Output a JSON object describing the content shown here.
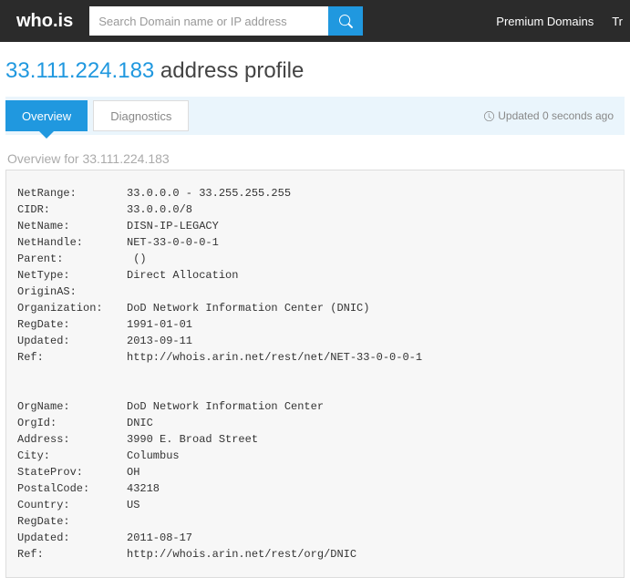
{
  "header": {
    "logo_text": "who.is",
    "search_placeholder": "Search Domain name or IP address",
    "nav": {
      "premium": "Premium Domains",
      "trunc": "Tr"
    }
  },
  "page": {
    "ip": "33.111.224.183",
    "title_suffix": " address profile"
  },
  "tabs": {
    "overview": "Overview",
    "diagnostics": "Diagnostics",
    "updated": "Updated 0 seconds ago"
  },
  "section": {
    "overview_prefix": "Overview for ",
    "overview_ip": "33.111.224.183"
  },
  "whois": {
    "block1": [
      {
        "k": "NetRange:",
        "v": "33.0.0.0 - 33.255.255.255"
      },
      {
        "k": "CIDR:",
        "v": "33.0.0.0/8"
      },
      {
        "k": "NetName:",
        "v": "DISN-IP-LEGACY"
      },
      {
        "k": "NetHandle:",
        "v": "NET-33-0-0-0-1"
      },
      {
        "k": "Parent:",
        "v": " ()"
      },
      {
        "k": "NetType:",
        "v": "Direct Allocation"
      },
      {
        "k": "OriginAS:",
        "v": ""
      },
      {
        "k": "Organization:",
        "v": "DoD Network Information Center (DNIC)"
      },
      {
        "k": "RegDate:",
        "v": "1991-01-01"
      },
      {
        "k": "Updated:",
        "v": "2013-09-11"
      },
      {
        "k": "Ref:",
        "v": "http://whois.arin.net/rest/net/NET-33-0-0-0-1"
      }
    ],
    "block2": [
      {
        "k": "OrgName:",
        "v": "DoD Network Information Center"
      },
      {
        "k": "OrgId:",
        "v": "DNIC"
      },
      {
        "k": "Address:",
        "v": "3990 E. Broad Street"
      },
      {
        "k": "City:",
        "v": "Columbus"
      },
      {
        "k": "StateProv:",
        "v": "OH"
      },
      {
        "k": "PostalCode:",
        "v": "43218"
      },
      {
        "k": "Country:",
        "v": "US"
      },
      {
        "k": "RegDate:",
        "v": ""
      },
      {
        "k": "Updated:",
        "v": "2011-08-17"
      },
      {
        "k": "Ref:",
        "v": "http://whois.arin.net/rest/org/DNIC"
      }
    ]
  }
}
